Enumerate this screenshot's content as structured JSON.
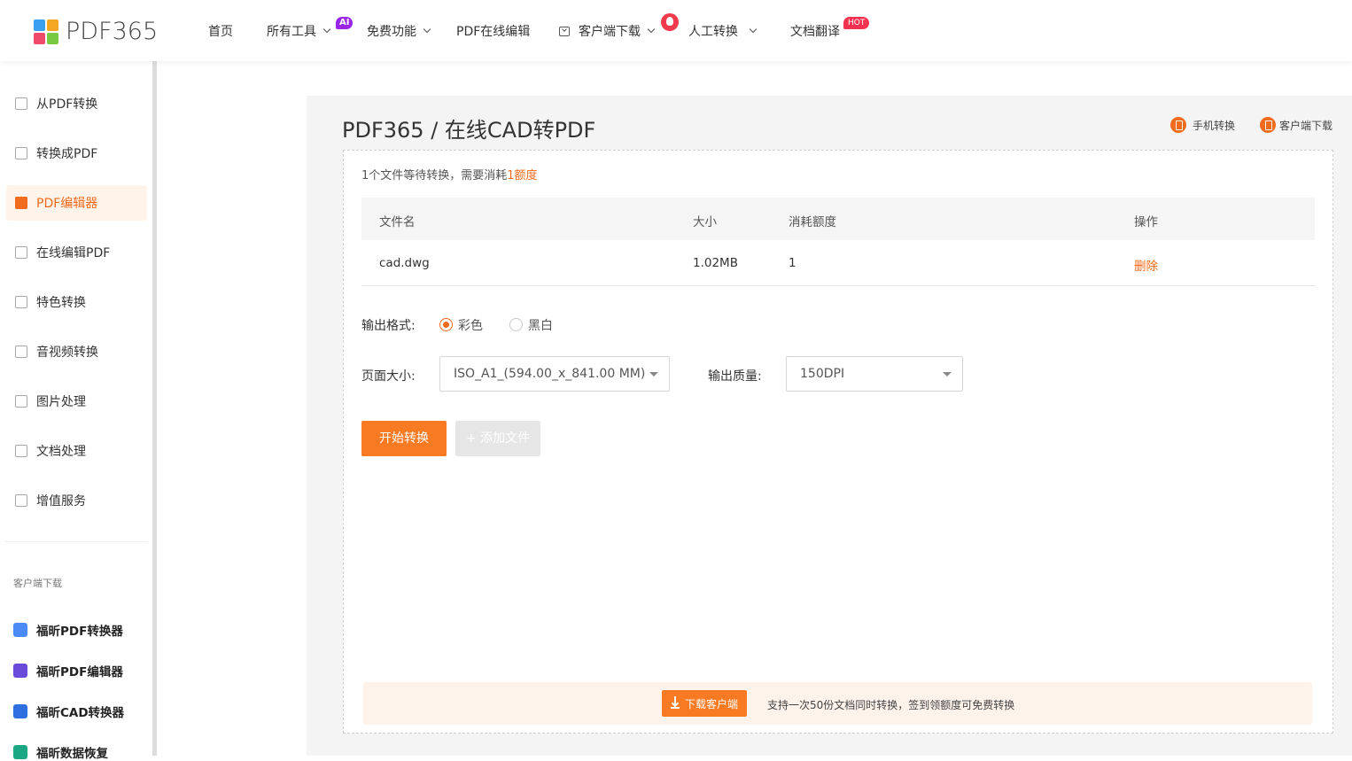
{
  "header": {
    "logo_text": "PDF365",
    "nav": {
      "home": "首页",
      "all_tools": "所有工具",
      "ai_badge": "AI",
      "free": "免费功能",
      "online_edit": "PDF在线编辑",
      "client_download": "客户端下载",
      "manual_convert": "人工转换",
      "doc_translate": "文档翻译",
      "hot_badge": "HOT"
    }
  },
  "sidebar": {
    "items": [
      {
        "label": "从PDF转换",
        "icon": "pdf-from-icon"
      },
      {
        "label": "转换成PDF",
        "icon": "pdf-to-icon"
      },
      {
        "label": "PDF编辑器",
        "icon": "pdf-editor-icon"
      },
      {
        "label": "在线编辑PDF",
        "icon": "online-edit-icon"
      },
      {
        "label": "特色转换",
        "icon": "special-convert-icon"
      },
      {
        "label": "音视频转换",
        "icon": "av-convert-icon"
      },
      {
        "label": "图片处理",
        "icon": "image-icon"
      },
      {
        "label": "文档处理",
        "icon": "document-icon"
      },
      {
        "label": "增值服务",
        "icon": "service-icon"
      }
    ],
    "active_index": 2,
    "download_caption": "客户端下载",
    "apps": [
      {
        "label": "福昕PDF转换器",
        "color": "#4c8bf5"
      },
      {
        "label": "福昕PDF编辑器",
        "color": "#6a4ad8"
      },
      {
        "label": "福昕CAD转换器",
        "color": "#2f6fe0"
      },
      {
        "label": "福昕数据恢复",
        "color": "#1ba784"
      }
    ]
  },
  "main": {
    "title": "PDF365 / 在线CAD转PDF",
    "mobile_link": "手机转换",
    "client_link": "客户端下载",
    "info_prefix": "1个文件等待转换，需要消耗",
    "info_highlight": "1额度",
    "table": {
      "headers": {
        "name": "文件名",
        "size": "大小",
        "cost": "消耗额度",
        "action": "操作"
      },
      "rows": [
        {
          "name": "cad.dwg",
          "size": "1.02MB",
          "cost": "1",
          "action": "删除"
        }
      ]
    },
    "output_format": {
      "label": "输出格式:",
      "options": [
        "彩色",
        "黑白"
      ],
      "selected": "彩色"
    },
    "page_size": {
      "label": "页面大小:",
      "value": "ISO_A1_(594.00_x_841.00 MM)"
    },
    "quality": {
      "label": "输出质量:",
      "value": "150DPI"
    },
    "start_button": "开始转换",
    "add_button": "+ 添加文件",
    "banner": {
      "button": "下载客户端",
      "text": "支持一次50份文档同时转换，签到领额度可免费转换"
    }
  },
  "colors": {
    "accent": "#f26a1b",
    "button": "#f87a22"
  }
}
